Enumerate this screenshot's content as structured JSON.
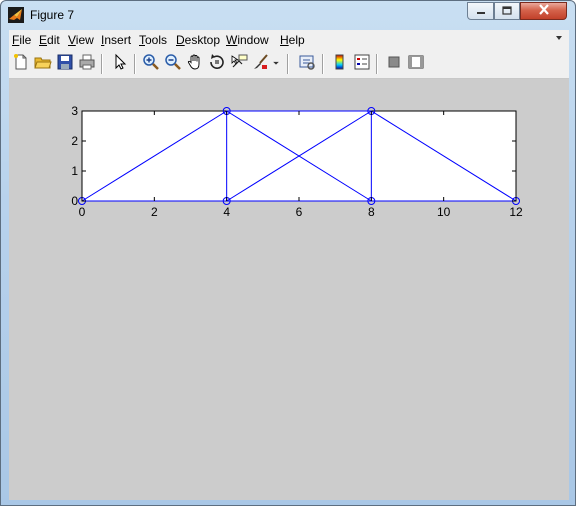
{
  "window": {
    "title": "Figure 7",
    "controls": {
      "minimize": "minimize",
      "maximize": "maximize",
      "close": "close"
    }
  },
  "menu": {
    "items": [
      {
        "label": "File",
        "accel": "F",
        "rest": "ile"
      },
      {
        "label": "Edit",
        "accel": "E",
        "rest": "dit"
      },
      {
        "label": "View",
        "accel": "V",
        "rest": "iew"
      },
      {
        "label": "Insert",
        "accel": "I",
        "rest": "nsert"
      },
      {
        "label": "Tools",
        "accel": "T",
        "rest": "ools"
      },
      {
        "label": "Desktop",
        "accel": "D",
        "rest": "esktop"
      },
      {
        "label": "Window",
        "accel": "W",
        "rest": "indow"
      },
      {
        "label": "Help",
        "accel": "H",
        "rest": "elp"
      }
    ]
  },
  "toolbar": {
    "buttons": [
      "new-figure-icon",
      "open-file-icon",
      "save-icon",
      "print-icon",
      "select-pointer-icon",
      "zoom-in-icon",
      "zoom-out-icon",
      "pan-hand-icon",
      "rotate-3d-icon",
      "data-cursor-icon",
      "brush-icon",
      "link-plot-icon",
      "colorbar-icon",
      "legend-icon",
      "hide-plot-tools-icon",
      "show-plot-tools-icon"
    ]
  },
  "colors": {
    "line": "#0000ff",
    "figure_bg": "#cccccc",
    "axes_bg": "#ffffff"
  },
  "chart_data": {
    "type": "line",
    "title": "",
    "xlabel": "",
    "ylabel": "",
    "xlim": [
      0,
      12
    ],
    "ylim": [
      0,
      3
    ],
    "xticks": [
      0,
      2,
      4,
      6,
      8,
      10,
      12
    ],
    "yticks": [
      0,
      1,
      2,
      3
    ],
    "grid": false,
    "marker": "o",
    "nodes": [
      {
        "x": 0,
        "y": 0
      },
      {
        "x": 4,
        "y": 0
      },
      {
        "x": 8,
        "y": 0
      },
      {
        "x": 12,
        "y": 0
      },
      {
        "x": 4,
        "y": 3
      },
      {
        "x": 8,
        "y": 3
      }
    ],
    "members": [
      {
        "x": [
          0,
          4
        ],
        "y": [
          0,
          0
        ]
      },
      {
        "x": [
          4,
          8
        ],
        "y": [
          0,
          0
        ]
      },
      {
        "x": [
          8,
          12
        ],
        "y": [
          0,
          0
        ]
      },
      {
        "x": [
          4,
          8
        ],
        "y": [
          3,
          3
        ]
      },
      {
        "x": [
          0,
          4
        ],
        "y": [
          0,
          3
        ]
      },
      {
        "x": [
          4,
          4
        ],
        "y": [
          0,
          3
        ]
      },
      {
        "x": [
          4,
          8
        ],
        "y": [
          3,
          0
        ]
      },
      {
        "x": [
          4,
          8
        ],
        "y": [
          0,
          3
        ]
      },
      {
        "x": [
          8,
          8
        ],
        "y": [
          0,
          3
        ]
      },
      {
        "x": [
          8,
          12
        ],
        "y": [
          3,
          0
        ]
      }
    ]
  }
}
